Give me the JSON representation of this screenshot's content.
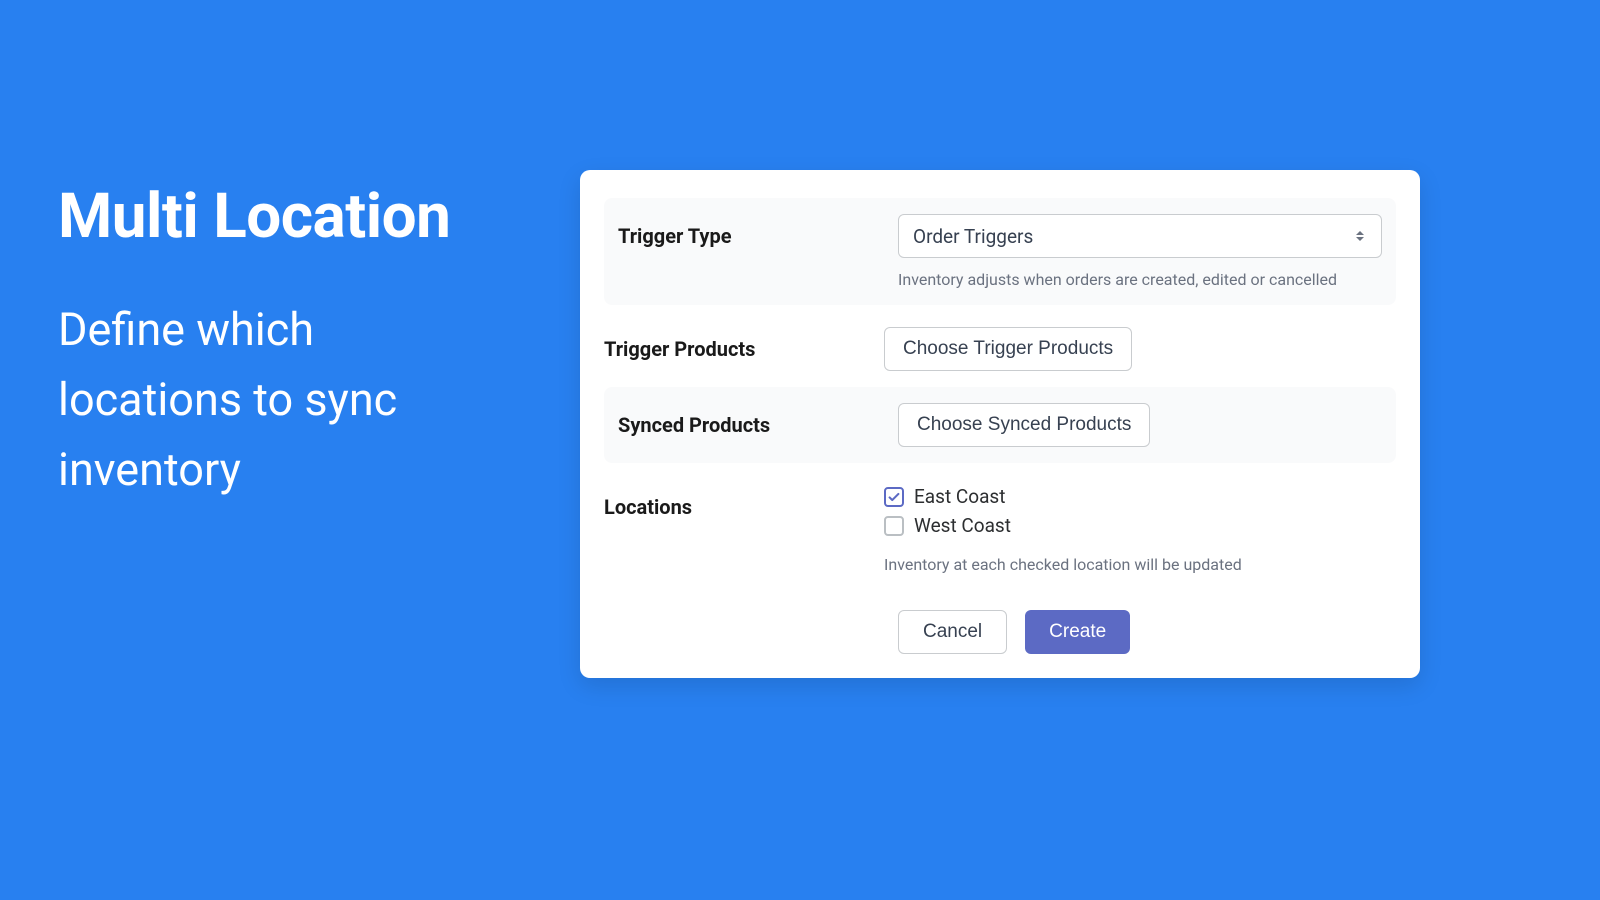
{
  "hero": {
    "title": "Multi Location",
    "subtitle": "Define which locations to sync inventory"
  },
  "form": {
    "trigger_type": {
      "label": "Trigger Type",
      "selected": "Order Triggers",
      "helper": "Inventory adjusts when orders are created, edited or cancelled"
    },
    "trigger_products": {
      "label": "Trigger Products",
      "button": "Choose Trigger Products"
    },
    "synced_products": {
      "label": "Synced Products",
      "button": "Choose Synced Products"
    },
    "locations": {
      "label": "Locations",
      "options": [
        {
          "label": "East Coast",
          "checked": true
        },
        {
          "label": "West Coast",
          "checked": false
        }
      ],
      "helper": "Inventory at each checked location will be updated"
    },
    "actions": {
      "cancel": "Cancel",
      "create": "Create"
    }
  }
}
